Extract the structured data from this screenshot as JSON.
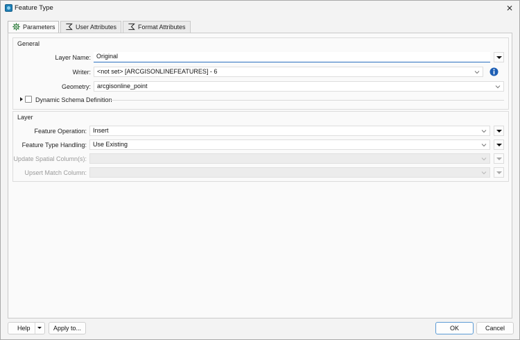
{
  "window": {
    "title": "Feature Type",
    "close": "✕"
  },
  "tabs": [
    {
      "label": "Parameters",
      "icon": "gear-icon"
    },
    {
      "label": "User Attributes",
      "icon": "sigma-icon"
    },
    {
      "label": "Format Attributes",
      "icon": "sigma-icon"
    }
  ],
  "general": {
    "title": "General",
    "layer_name_label": "Layer Name:",
    "layer_name_value": "Original",
    "writer_label": "Writer:",
    "writer_value": "<not set> [ARCGISONLINEFEATURES] - 6",
    "geometry_label": "Geometry:",
    "geometry_value": "arcgisonline_point",
    "dynamic_schema_label": "Dynamic Schema Definition"
  },
  "layer": {
    "title": "Layer",
    "feature_operation_label": "Feature Operation:",
    "feature_operation_value": "Insert",
    "feature_type_handling_label": "Feature Type Handling:",
    "feature_type_handling_value": "Use Existing",
    "update_spatial_label": "Update Spatial Column(s):",
    "update_spatial_value": "",
    "upsert_match_label": "Upsert Match Column:",
    "upsert_match_value": ""
  },
  "footer": {
    "help_label": "Help",
    "apply_label": "Apply to...",
    "ok_label": "OK",
    "cancel_label": "Cancel"
  },
  "colors": {
    "accent": "#2a6fbf",
    "info": "#1e5fb4"
  }
}
